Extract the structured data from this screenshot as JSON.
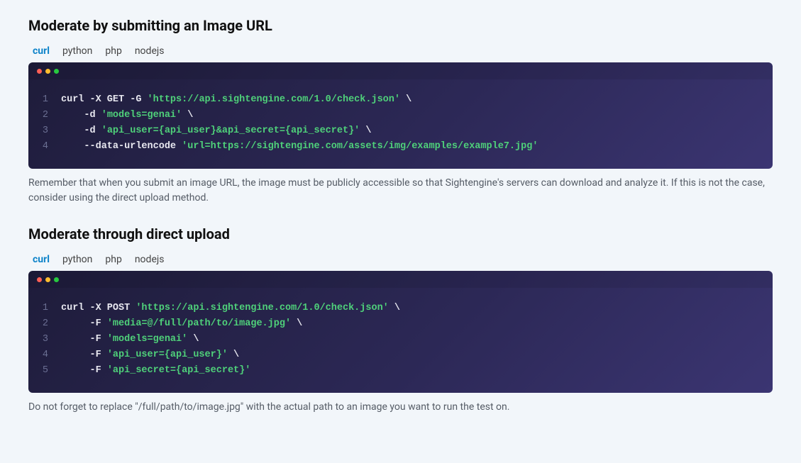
{
  "sections": [
    {
      "heading": "Moderate by submitting an Image URL",
      "tabs": [
        "curl",
        "python",
        "php",
        "nodejs"
      ],
      "active_tab": 0,
      "code_lines": [
        [
          {
            "t": "curl -X GET -G ",
            "c": "code"
          },
          {
            "t": "'https://api.sightengine.com/1.0/check.json'",
            "c": "str"
          },
          {
            "t": " \\",
            "c": "code"
          }
        ],
        [
          {
            "t": "    -d ",
            "c": "code"
          },
          {
            "t": "'models=genai'",
            "c": "str"
          },
          {
            "t": " \\",
            "c": "code"
          }
        ],
        [
          {
            "t": "    -d ",
            "c": "code"
          },
          {
            "t": "'api_user={api_user}&api_secret={api_secret}'",
            "c": "str"
          },
          {
            "t": " \\",
            "c": "code"
          }
        ],
        [
          {
            "t": "    --data-urlencode ",
            "c": "code"
          },
          {
            "t": "'url=https://sightengine.com/assets/img/examples/example7.jpg'",
            "c": "str"
          }
        ]
      ],
      "note": "Remember that when you submit an image URL, the image must be publicly accessible so that Sightengine's servers can download and analyze it. If this is not the case, consider using the direct upload method."
    },
    {
      "heading": "Moderate through direct upload",
      "tabs": [
        "curl",
        "python",
        "php",
        "nodejs"
      ],
      "active_tab": 0,
      "code_lines": [
        [
          {
            "t": "curl -X POST ",
            "c": "code"
          },
          {
            "t": "'https://api.sightengine.com/1.0/check.json'",
            "c": "str"
          },
          {
            "t": " \\",
            "c": "code"
          }
        ],
        [
          {
            "t": "     -F ",
            "c": "code"
          },
          {
            "t": "'media=@/full/path/to/image.jpg'",
            "c": "str"
          },
          {
            "t": " \\",
            "c": "code"
          }
        ],
        [
          {
            "t": "     -F ",
            "c": "code"
          },
          {
            "t": "'models=genai'",
            "c": "str"
          },
          {
            "t": " \\",
            "c": "code"
          }
        ],
        [
          {
            "t": "     -F ",
            "c": "code"
          },
          {
            "t": "'api_user={api_user}'",
            "c": "str"
          },
          {
            "t": " \\",
            "c": "code"
          }
        ],
        [
          {
            "t": "     -F ",
            "c": "code"
          },
          {
            "t": "'api_secret={api_secret}'",
            "c": "str"
          }
        ]
      ],
      "note": "Do not forget to replace \"/full/path/to/image.jpg\" with the actual path to an image you want to run the test on."
    }
  ]
}
